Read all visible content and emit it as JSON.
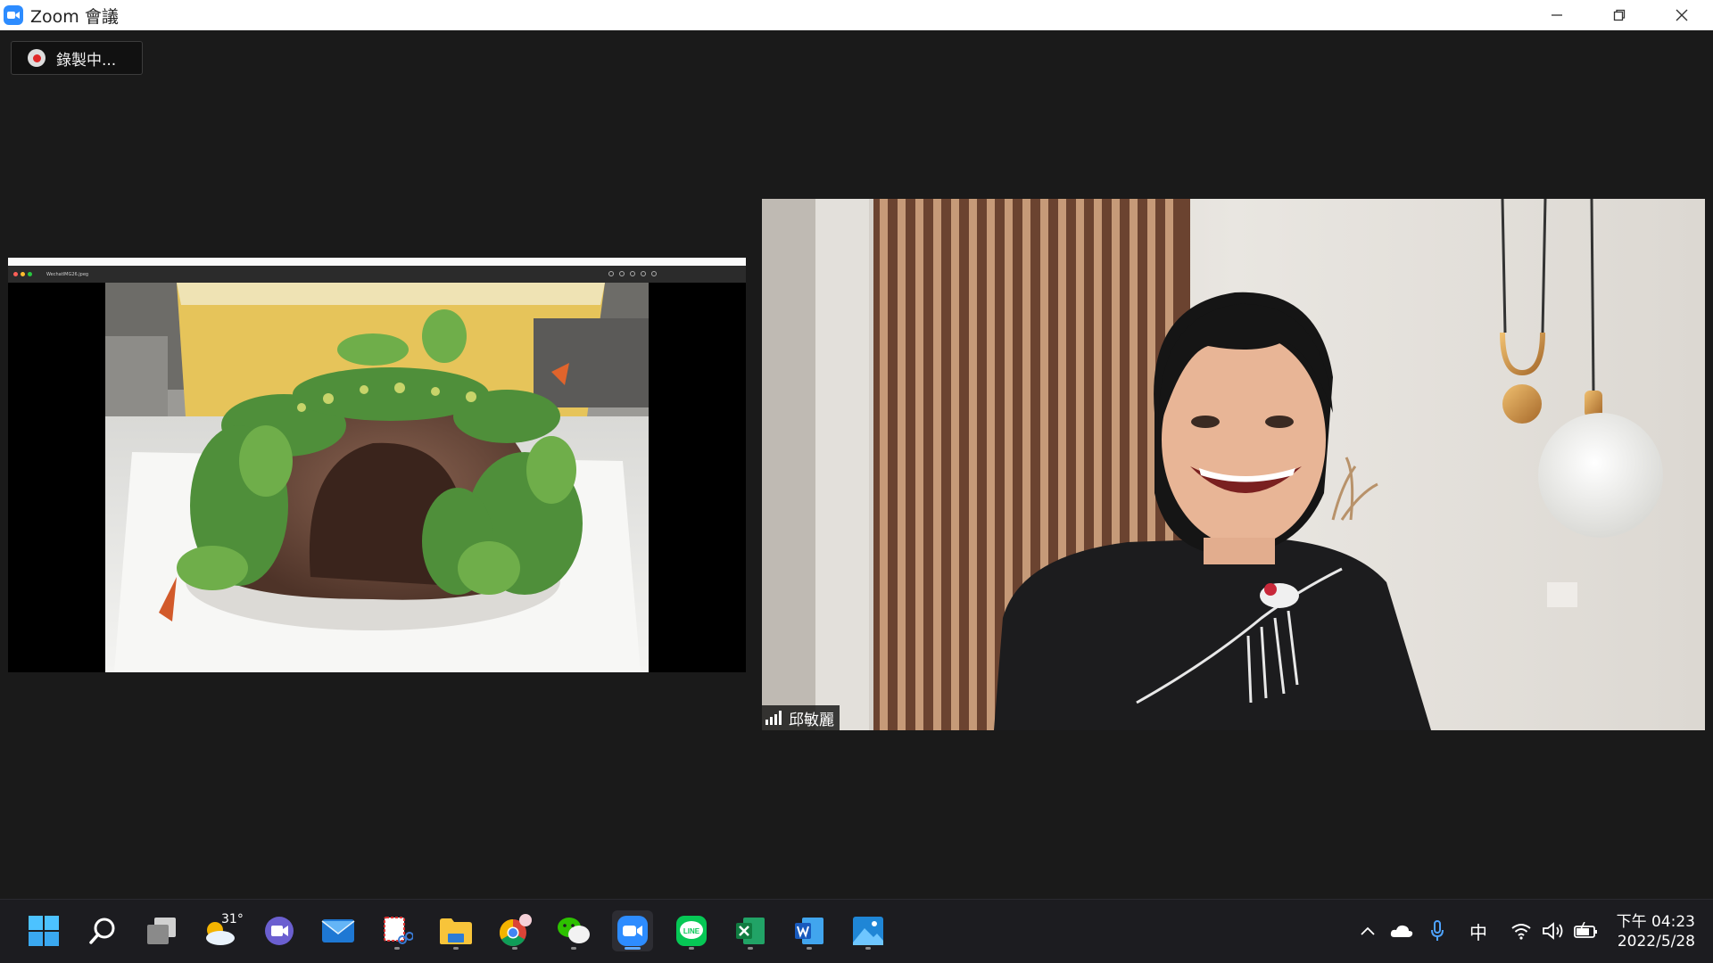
{
  "window": {
    "title": "Zoom 會議"
  },
  "recording": {
    "label": "錄製中..."
  },
  "share": {
    "viewer_filename": "WechatIMG26.jpeg"
  },
  "participant": {
    "name": "邱敏麗"
  },
  "taskbar": {
    "weather_temp": "31°",
    "ime_label": "中",
    "time": "下午 04:23",
    "date": "2022/5/28",
    "apps": [
      "start",
      "search",
      "task-view",
      "weather",
      "teams",
      "mail",
      "snipping-tool",
      "file-explorer",
      "chrome",
      "wechat",
      "zoom",
      "line",
      "excel",
      "word",
      "photos"
    ]
  },
  "colors": {
    "zoom_blue": "#2d8cff",
    "recording_red": "#e02828",
    "background": "#1a1a1a",
    "taskbar": "#1c1c20"
  }
}
